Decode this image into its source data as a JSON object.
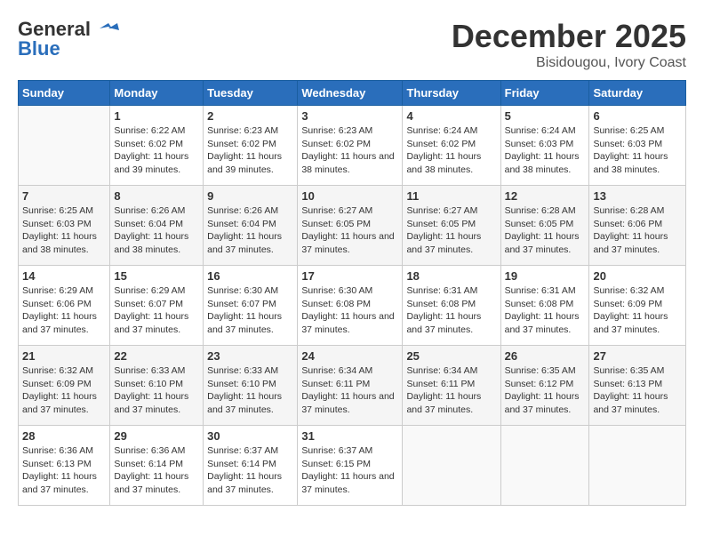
{
  "header": {
    "logo_line1": "General",
    "logo_line2": "Blue",
    "title": "December 2025",
    "subtitle": "Bisidougou, Ivory Coast"
  },
  "calendar": {
    "weekdays": [
      "Sunday",
      "Monday",
      "Tuesday",
      "Wednesday",
      "Thursday",
      "Friday",
      "Saturday"
    ],
    "weeks": [
      [
        {
          "day": "",
          "sunrise": "",
          "sunset": "",
          "daylight": ""
        },
        {
          "day": "1",
          "sunrise": "6:22 AM",
          "sunset": "6:02 PM",
          "daylight": "11 hours and 39 minutes."
        },
        {
          "day": "2",
          "sunrise": "6:23 AM",
          "sunset": "6:02 PM",
          "daylight": "11 hours and 39 minutes."
        },
        {
          "day": "3",
          "sunrise": "6:23 AM",
          "sunset": "6:02 PM",
          "daylight": "11 hours and 38 minutes."
        },
        {
          "day": "4",
          "sunrise": "6:24 AM",
          "sunset": "6:02 PM",
          "daylight": "11 hours and 38 minutes."
        },
        {
          "day": "5",
          "sunrise": "6:24 AM",
          "sunset": "6:03 PM",
          "daylight": "11 hours and 38 minutes."
        },
        {
          "day": "6",
          "sunrise": "6:25 AM",
          "sunset": "6:03 PM",
          "daylight": "11 hours and 38 minutes."
        }
      ],
      [
        {
          "day": "7",
          "sunrise": "6:25 AM",
          "sunset": "6:03 PM",
          "daylight": "11 hours and 38 minutes."
        },
        {
          "day": "8",
          "sunrise": "6:26 AM",
          "sunset": "6:04 PM",
          "daylight": "11 hours and 38 minutes."
        },
        {
          "day": "9",
          "sunrise": "6:26 AM",
          "sunset": "6:04 PM",
          "daylight": "11 hours and 37 minutes."
        },
        {
          "day": "10",
          "sunrise": "6:27 AM",
          "sunset": "6:05 PM",
          "daylight": "11 hours and 37 minutes."
        },
        {
          "day": "11",
          "sunrise": "6:27 AM",
          "sunset": "6:05 PM",
          "daylight": "11 hours and 37 minutes."
        },
        {
          "day": "12",
          "sunrise": "6:28 AM",
          "sunset": "6:05 PM",
          "daylight": "11 hours and 37 minutes."
        },
        {
          "day": "13",
          "sunrise": "6:28 AM",
          "sunset": "6:06 PM",
          "daylight": "11 hours and 37 minutes."
        }
      ],
      [
        {
          "day": "14",
          "sunrise": "6:29 AM",
          "sunset": "6:06 PM",
          "daylight": "11 hours and 37 minutes."
        },
        {
          "day": "15",
          "sunrise": "6:29 AM",
          "sunset": "6:07 PM",
          "daylight": "11 hours and 37 minutes."
        },
        {
          "day": "16",
          "sunrise": "6:30 AM",
          "sunset": "6:07 PM",
          "daylight": "11 hours and 37 minutes."
        },
        {
          "day": "17",
          "sunrise": "6:30 AM",
          "sunset": "6:08 PM",
          "daylight": "11 hours and 37 minutes."
        },
        {
          "day": "18",
          "sunrise": "6:31 AM",
          "sunset": "6:08 PM",
          "daylight": "11 hours and 37 minutes."
        },
        {
          "day": "19",
          "sunrise": "6:31 AM",
          "sunset": "6:08 PM",
          "daylight": "11 hours and 37 minutes."
        },
        {
          "day": "20",
          "sunrise": "6:32 AM",
          "sunset": "6:09 PM",
          "daylight": "11 hours and 37 minutes."
        }
      ],
      [
        {
          "day": "21",
          "sunrise": "6:32 AM",
          "sunset": "6:09 PM",
          "daylight": "11 hours and 37 minutes."
        },
        {
          "day": "22",
          "sunrise": "6:33 AM",
          "sunset": "6:10 PM",
          "daylight": "11 hours and 37 minutes."
        },
        {
          "day": "23",
          "sunrise": "6:33 AM",
          "sunset": "6:10 PM",
          "daylight": "11 hours and 37 minutes."
        },
        {
          "day": "24",
          "sunrise": "6:34 AM",
          "sunset": "6:11 PM",
          "daylight": "11 hours and 37 minutes."
        },
        {
          "day": "25",
          "sunrise": "6:34 AM",
          "sunset": "6:11 PM",
          "daylight": "11 hours and 37 minutes."
        },
        {
          "day": "26",
          "sunrise": "6:35 AM",
          "sunset": "6:12 PM",
          "daylight": "11 hours and 37 minutes."
        },
        {
          "day": "27",
          "sunrise": "6:35 AM",
          "sunset": "6:13 PM",
          "daylight": "11 hours and 37 minutes."
        }
      ],
      [
        {
          "day": "28",
          "sunrise": "6:36 AM",
          "sunset": "6:13 PM",
          "daylight": "11 hours and 37 minutes."
        },
        {
          "day": "29",
          "sunrise": "6:36 AM",
          "sunset": "6:14 PM",
          "daylight": "11 hours and 37 minutes."
        },
        {
          "day": "30",
          "sunrise": "6:37 AM",
          "sunset": "6:14 PM",
          "daylight": "11 hours and 37 minutes."
        },
        {
          "day": "31",
          "sunrise": "6:37 AM",
          "sunset": "6:15 PM",
          "daylight": "11 hours and 37 minutes."
        },
        {
          "day": "",
          "sunrise": "",
          "sunset": "",
          "daylight": ""
        },
        {
          "day": "",
          "sunrise": "",
          "sunset": "",
          "daylight": ""
        },
        {
          "day": "",
          "sunrise": "",
          "sunset": "",
          "daylight": ""
        }
      ]
    ]
  }
}
